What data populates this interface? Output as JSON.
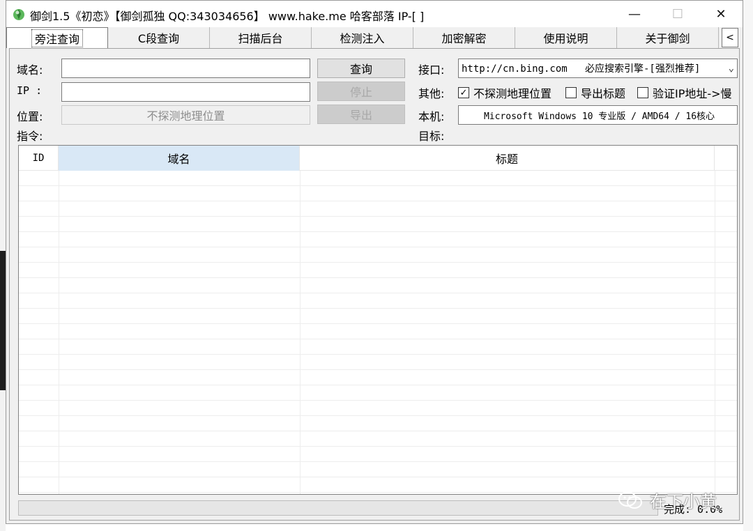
{
  "window": {
    "title": "御剑1.5《初恋》【御剑孤独 QQ:343034656】 www.hake.me 哈客部落 IP-[ ]",
    "min_glyph": "—",
    "max_glyph": "☐",
    "close_glyph": "✕"
  },
  "tabs": [
    {
      "label": "旁注查询",
      "active": true
    },
    {
      "label": "C段查询"
    },
    {
      "label": "扫描后台"
    },
    {
      "label": "检测注入"
    },
    {
      "label": "加密解密"
    },
    {
      "label": "使用说明"
    },
    {
      "label": "关于御剑"
    }
  ],
  "tab_scroll_glyph": "<",
  "form": {
    "domain_label": "域名:",
    "ip_label": "IP  :",
    "location_label": "位置:",
    "command_label": "指令:",
    "domain_value": "",
    "ip_value": "",
    "location_value": "不探测地理位置",
    "query_button": "查询",
    "stop_button": "停止",
    "export_button": "导出",
    "interface_label": "接口:",
    "interface_value": "http://cn.bing.com   必应搜索引擎-[强烈推荐]",
    "other_label": "其他:",
    "opt_no_geo": "不探测地理位置",
    "opt_no_geo_checked": true,
    "opt_export_title": "导出标题",
    "opt_export_title_checked": false,
    "opt_verify_ip": "验证IP地址->慢",
    "opt_verify_ip_checked": false,
    "local_label": "本机:",
    "local_value": "Microsoft Windows 10 专业版 / AMD64 / 16核心",
    "target_label": "目标:"
  },
  "table": {
    "columns": [
      "ID",
      "域名",
      "标题"
    ],
    "rows": []
  },
  "status": {
    "progress": 0.0,
    "text": "完成: 0.0%"
  },
  "watermark": "在下小黄",
  "colors": {
    "header_selected": "#d9e8f6",
    "app_icon_green": "#4caf50"
  }
}
